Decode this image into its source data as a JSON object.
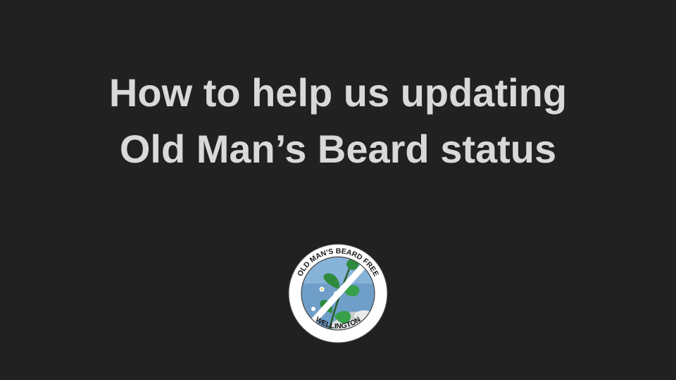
{
  "slide": {
    "title_line1": "How to help us updating",
    "title_line2": "Old Man’s Beard status"
  },
  "logo": {
    "top_text": "OLD MAN’S BEARD FREE",
    "bottom_text": "WELLINGTON"
  },
  "colors": {
    "background": "#212121",
    "title": "#d9d9d9",
    "leaf_green": "#2e8b3d",
    "sky_blue": "#6f9fc9"
  }
}
